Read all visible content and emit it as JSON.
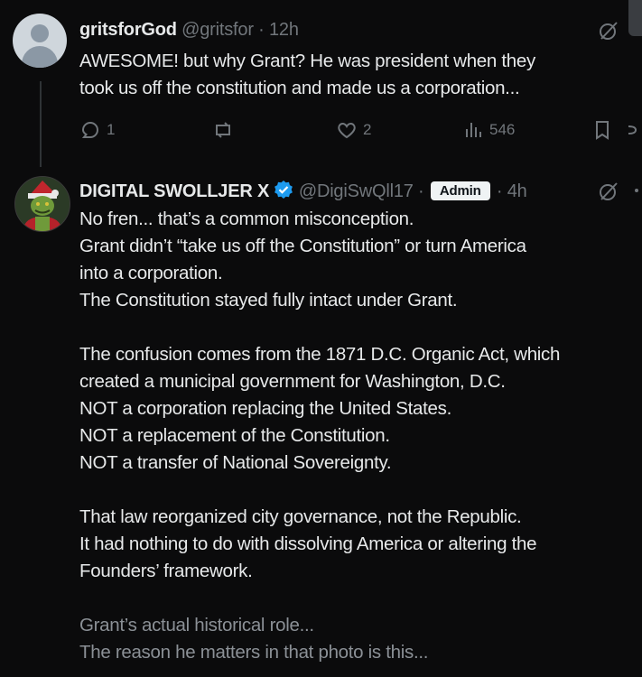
{
  "post1": {
    "display_name": "gritsforGod",
    "handle": "@gritsfor",
    "separator": "·",
    "time": "12h",
    "lines": [
      "AWESOME!   but why Grant?   He was president when they",
      "took us off the constitution and made us a corporation..."
    ],
    "actions": {
      "replies": "1",
      "reposts": "",
      "likes": "2",
      "views": "546"
    }
  },
  "post2": {
    "display_name": "DIGITAL SWOLLJER X",
    "handle": "@DigiSwQll17",
    "separator": "·",
    "badge": "Admin",
    "time": "· 4h",
    "lines": [
      "No fren... that’s a common misconception.",
      "Grant didn’t “take us off the Constitution” or turn America",
      "into a corporation.",
      "The Constitution stayed fully intact under Grant.",
      "",
      "The confusion comes from the 1871 D.C. Organic Act, which",
      "created a municipal government for Washington, D.C.",
      "NOT a corporation replacing the United States.",
      "NOT a replacement of the Constitution.",
      "NOT a transfer of National Sovereignty.",
      "",
      "That law reorganized city governance, not the Republic.",
      "It had nothing to do with dissolving America or altering the",
      "Founders’ framework.",
      "",
      "Grant’s actual historical role...",
      "The reason he matters in that photo is this..."
    ]
  },
  "colors": {
    "background": "#0b0b0c",
    "text": "#e7e9ea",
    "muted": "#71767b",
    "verified": "#1d9bf0"
  }
}
